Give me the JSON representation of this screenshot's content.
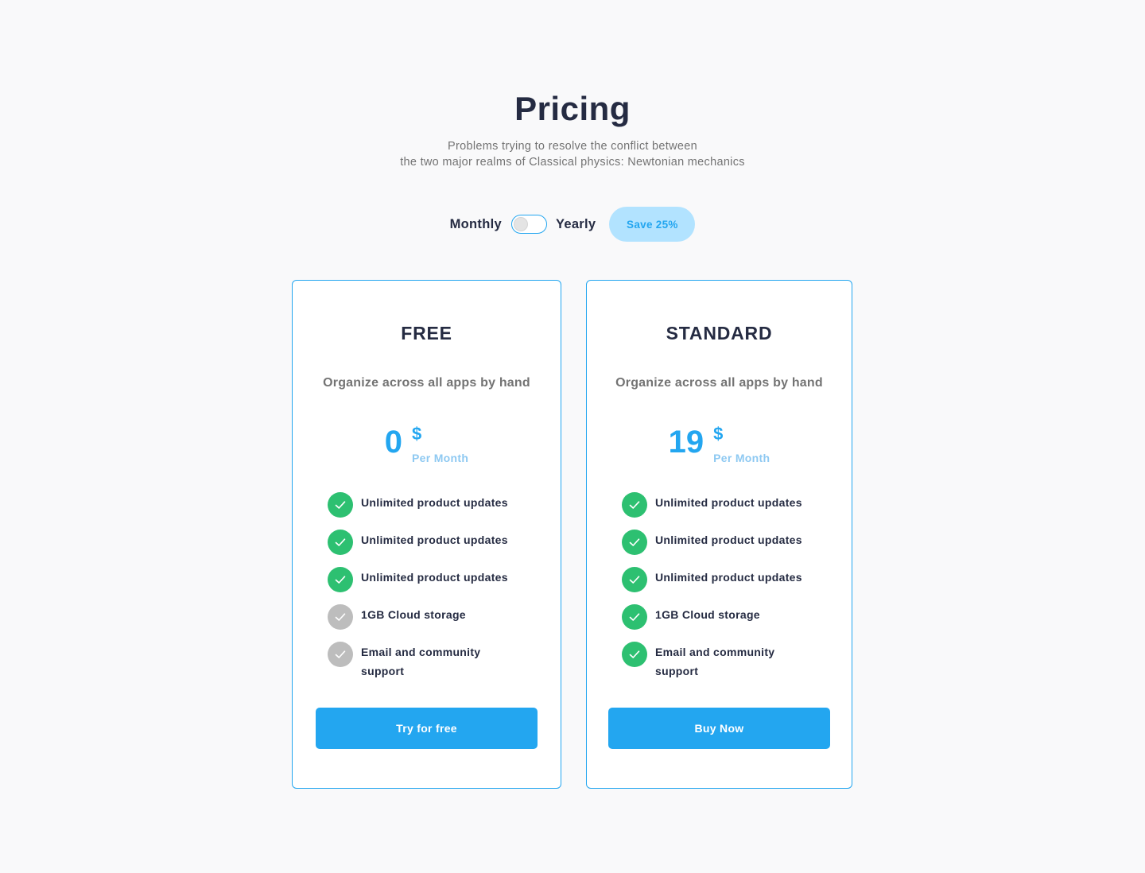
{
  "header": {
    "title": "Pricing",
    "subtitle_line1": "Problems trying to resolve the conflict between",
    "subtitle_line2": "the two major realms of Classical physics: Newtonian mechanics"
  },
  "billing": {
    "monthly_label": "Monthly",
    "yearly_label": "Yearly",
    "toggle_state": "monthly",
    "save_badge": "Save 25%"
  },
  "colors": {
    "accent": "#23a6f0",
    "check_active": "#2dc071",
    "check_inactive": "#bdbdbd",
    "badge_bg": "#b2e3ff",
    "heading": "#252b42",
    "muted": "#737373"
  },
  "plans": [
    {
      "name": "FREE",
      "description": "Organize across all apps by hand",
      "price": "0",
      "currency": "$",
      "period": "Per Month",
      "features": [
        {
          "text": "Unlimited product updates",
          "included": true,
          "icon": "check-circle-icon"
        },
        {
          "text": "Unlimited product updates",
          "included": true,
          "icon": "check-circle-icon"
        },
        {
          "text": "Unlimited product updates",
          "included": true,
          "icon": "check-circle-icon"
        },
        {
          "text": "1GB  Cloud storage",
          "included": false,
          "icon": "check-circle-icon"
        },
        {
          "text": "Email and community support",
          "included": false,
          "icon": "check-circle-icon"
        }
      ],
      "cta": "Try for free"
    },
    {
      "name": "STANDARD",
      "description": "Organize across all apps by hand",
      "price": "19",
      "currency": "$",
      "period": "Per Month",
      "features": [
        {
          "text": "Unlimited product updates",
          "included": true,
          "icon": "check-circle-icon"
        },
        {
          "text": "Unlimited product updates",
          "included": true,
          "icon": "check-circle-icon"
        },
        {
          "text": "Unlimited product updates",
          "included": true,
          "icon": "check-circle-icon"
        },
        {
          "text": "1GB  Cloud storage",
          "included": true,
          "icon": "check-circle-icon"
        },
        {
          "text": "Email and community support",
          "included": true,
          "icon": "check-circle-icon"
        }
      ],
      "cta": "Buy Now"
    }
  ]
}
